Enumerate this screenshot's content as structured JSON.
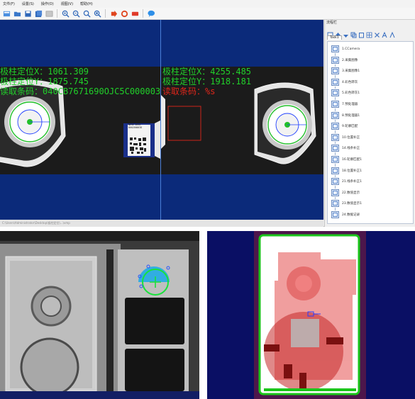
{
  "menu": [
    "文件(F)",
    "设置(S)",
    "操作(O)",
    "视图(V)",
    "帮助(H)"
  ],
  "toolbar_icons": [
    "new-icon",
    "open-icon",
    "save-icon",
    "save-all-icon",
    "image-icon",
    "zoom-in-icon",
    "zoom-out-icon",
    "zoom-fit-icon",
    "zoom-actual-icon",
    "run-once-icon",
    "run-loop-icon",
    "stop-icon",
    "info-icon"
  ],
  "overlay": {
    "left": {
      "pos_x": "极柱定位X：1061.309",
      "pos_y": "极柱定位Y：1875.745",
      "barcode": "读取条码：040CB7671690OJC5C0000038"
    },
    "right": {
      "pos_x": "极柱定位X：4255.485",
      "pos_y": "极柱定位Y：1918.181",
      "barcode": "读取条码：%s"
    }
  },
  "qr_label": {
    "line1": "NESE 0992",
    "line2": "0002000038"
  },
  "statusbar": {
    "text": "C:\\Users\\Administrator\\Desktop\\极柱定位\\...\\vmp"
  },
  "panel": {
    "title": "流程栏",
    "tab": "Task1",
    "items": [
      {
        "label": "1.CCamera",
        "icon": "camera-icon"
      },
      {
        "label": "2.采集图像",
        "icon": "image-acquire-icon"
      },
      {
        "label": "3.采集图像1",
        "icon": "image-acquire-icon"
      },
      {
        "label": "4.彩色转灰",
        "icon": "color-convert-icon"
      },
      {
        "label": "5.彩色转灰1",
        "icon": "color-convert-icon"
      },
      {
        "label": "7.预处理器",
        "icon": "preprocess-icon"
      },
      {
        "label": "8.预处理器1",
        "icon": "preprocess-icon"
      },
      {
        "label": "9.轮廓匹配",
        "icon": "contour-match-icon"
      },
      {
        "label": "10.位置补正",
        "icon": "position-correct-icon"
      },
      {
        "label": "14.线条补正",
        "icon": "line-correct-icon"
      },
      {
        "label": "16.轮廓匹配1",
        "icon": "contour-match-icon"
      },
      {
        "label": "18.位置补正1",
        "icon": "position-correct-icon"
      },
      {
        "label": "21.线条补正1",
        "icon": "line-correct-icon"
      },
      {
        "label": "22.数值显示",
        "icon": "text-display-icon"
      },
      {
        "label": "23.数值显示1",
        "icon": "text-display-icon"
      },
      {
        "label": "24.数据记录",
        "icon": "data-record-icon"
      }
    ]
  },
  "colors": {
    "viewport_bg": "#0b2a7a",
    "overlay_green": "#21d02a",
    "overlay_red": "#e0261b",
    "roi_blue": "#1f66ff",
    "mask_red": "#e02a2a"
  }
}
